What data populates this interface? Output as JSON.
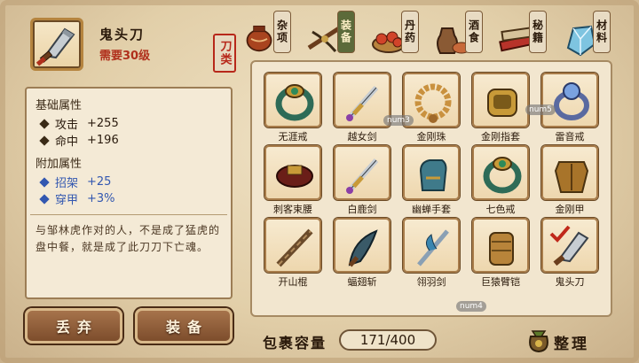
{
  "item": {
    "name": "鬼头刀",
    "requirement": "需要30级",
    "type_stamp": "刀类",
    "base_title": "基础属性",
    "base_attrs": [
      {
        "name": "攻击",
        "value": "+255"
      },
      {
        "name": "命中",
        "value": "+196"
      }
    ],
    "extra_title": "附加属性",
    "extra_attrs": [
      {
        "name": "招架",
        "value": "+25"
      },
      {
        "name": "穿甲",
        "value": "+3%"
      }
    ],
    "description": "与邹林虎作对的人，不是成了猛虎的盘中餐，就是成了此刀刀下亡魂。"
  },
  "buttons": {
    "discard": "丢弃",
    "equip": "装备",
    "sort": "整理"
  },
  "tabs": [
    {
      "label": "杂项",
      "icon": "clay-jar-icon",
      "active": false
    },
    {
      "label": "装备",
      "icon": "crossbow-icon",
      "active": true
    },
    {
      "label": "丹药",
      "icon": "pills-icon",
      "active": false
    },
    {
      "label": "酒食",
      "icon": "wine-food-icon",
      "active": false
    },
    {
      "label": "秘籍",
      "icon": "books-icon",
      "active": false
    },
    {
      "label": "材料",
      "icon": "crystal-icon",
      "active": false
    }
  ],
  "inventory": [
    {
      "name": "无涯戒",
      "icon": "ring-icon"
    },
    {
      "name": "越女剑",
      "icon": "sword-icon"
    },
    {
      "name": "金刚珠",
      "icon": "beads-icon"
    },
    {
      "name": "金刚指套",
      "icon": "finger-guard-icon"
    },
    {
      "name": "雷音戒",
      "icon": "gem-ring-icon"
    },
    {
      "name": "刺客束腰",
      "icon": "belt-icon"
    },
    {
      "name": "白鹿剑",
      "icon": "sword-icon"
    },
    {
      "name": "幽蝉手套",
      "icon": "glove-icon"
    },
    {
      "name": "七色戒",
      "icon": "ring-icon"
    },
    {
      "name": "金刚甲",
      "icon": "armor-icon"
    },
    {
      "name": "开山棍",
      "icon": "staff-icon"
    },
    {
      "name": "蝠翅斩",
      "icon": "blade-icon"
    },
    {
      "name": "翎羽剑",
      "icon": "feather-sword-icon"
    },
    {
      "name": "巨猿臂铠",
      "icon": "arm-guard-icon"
    },
    {
      "name": "鬼头刀",
      "icon": "broadsword-icon",
      "equipped": true
    }
  ],
  "capacity": {
    "label": "包裹容量",
    "value": "171/400"
  },
  "overlay_tags": [
    "num3",
    "num5",
    "num4"
  ],
  "colors": {
    "accent_red": "#b0301c",
    "attr_blue": "#3257b0",
    "parchment": "#f2e6cf"
  }
}
